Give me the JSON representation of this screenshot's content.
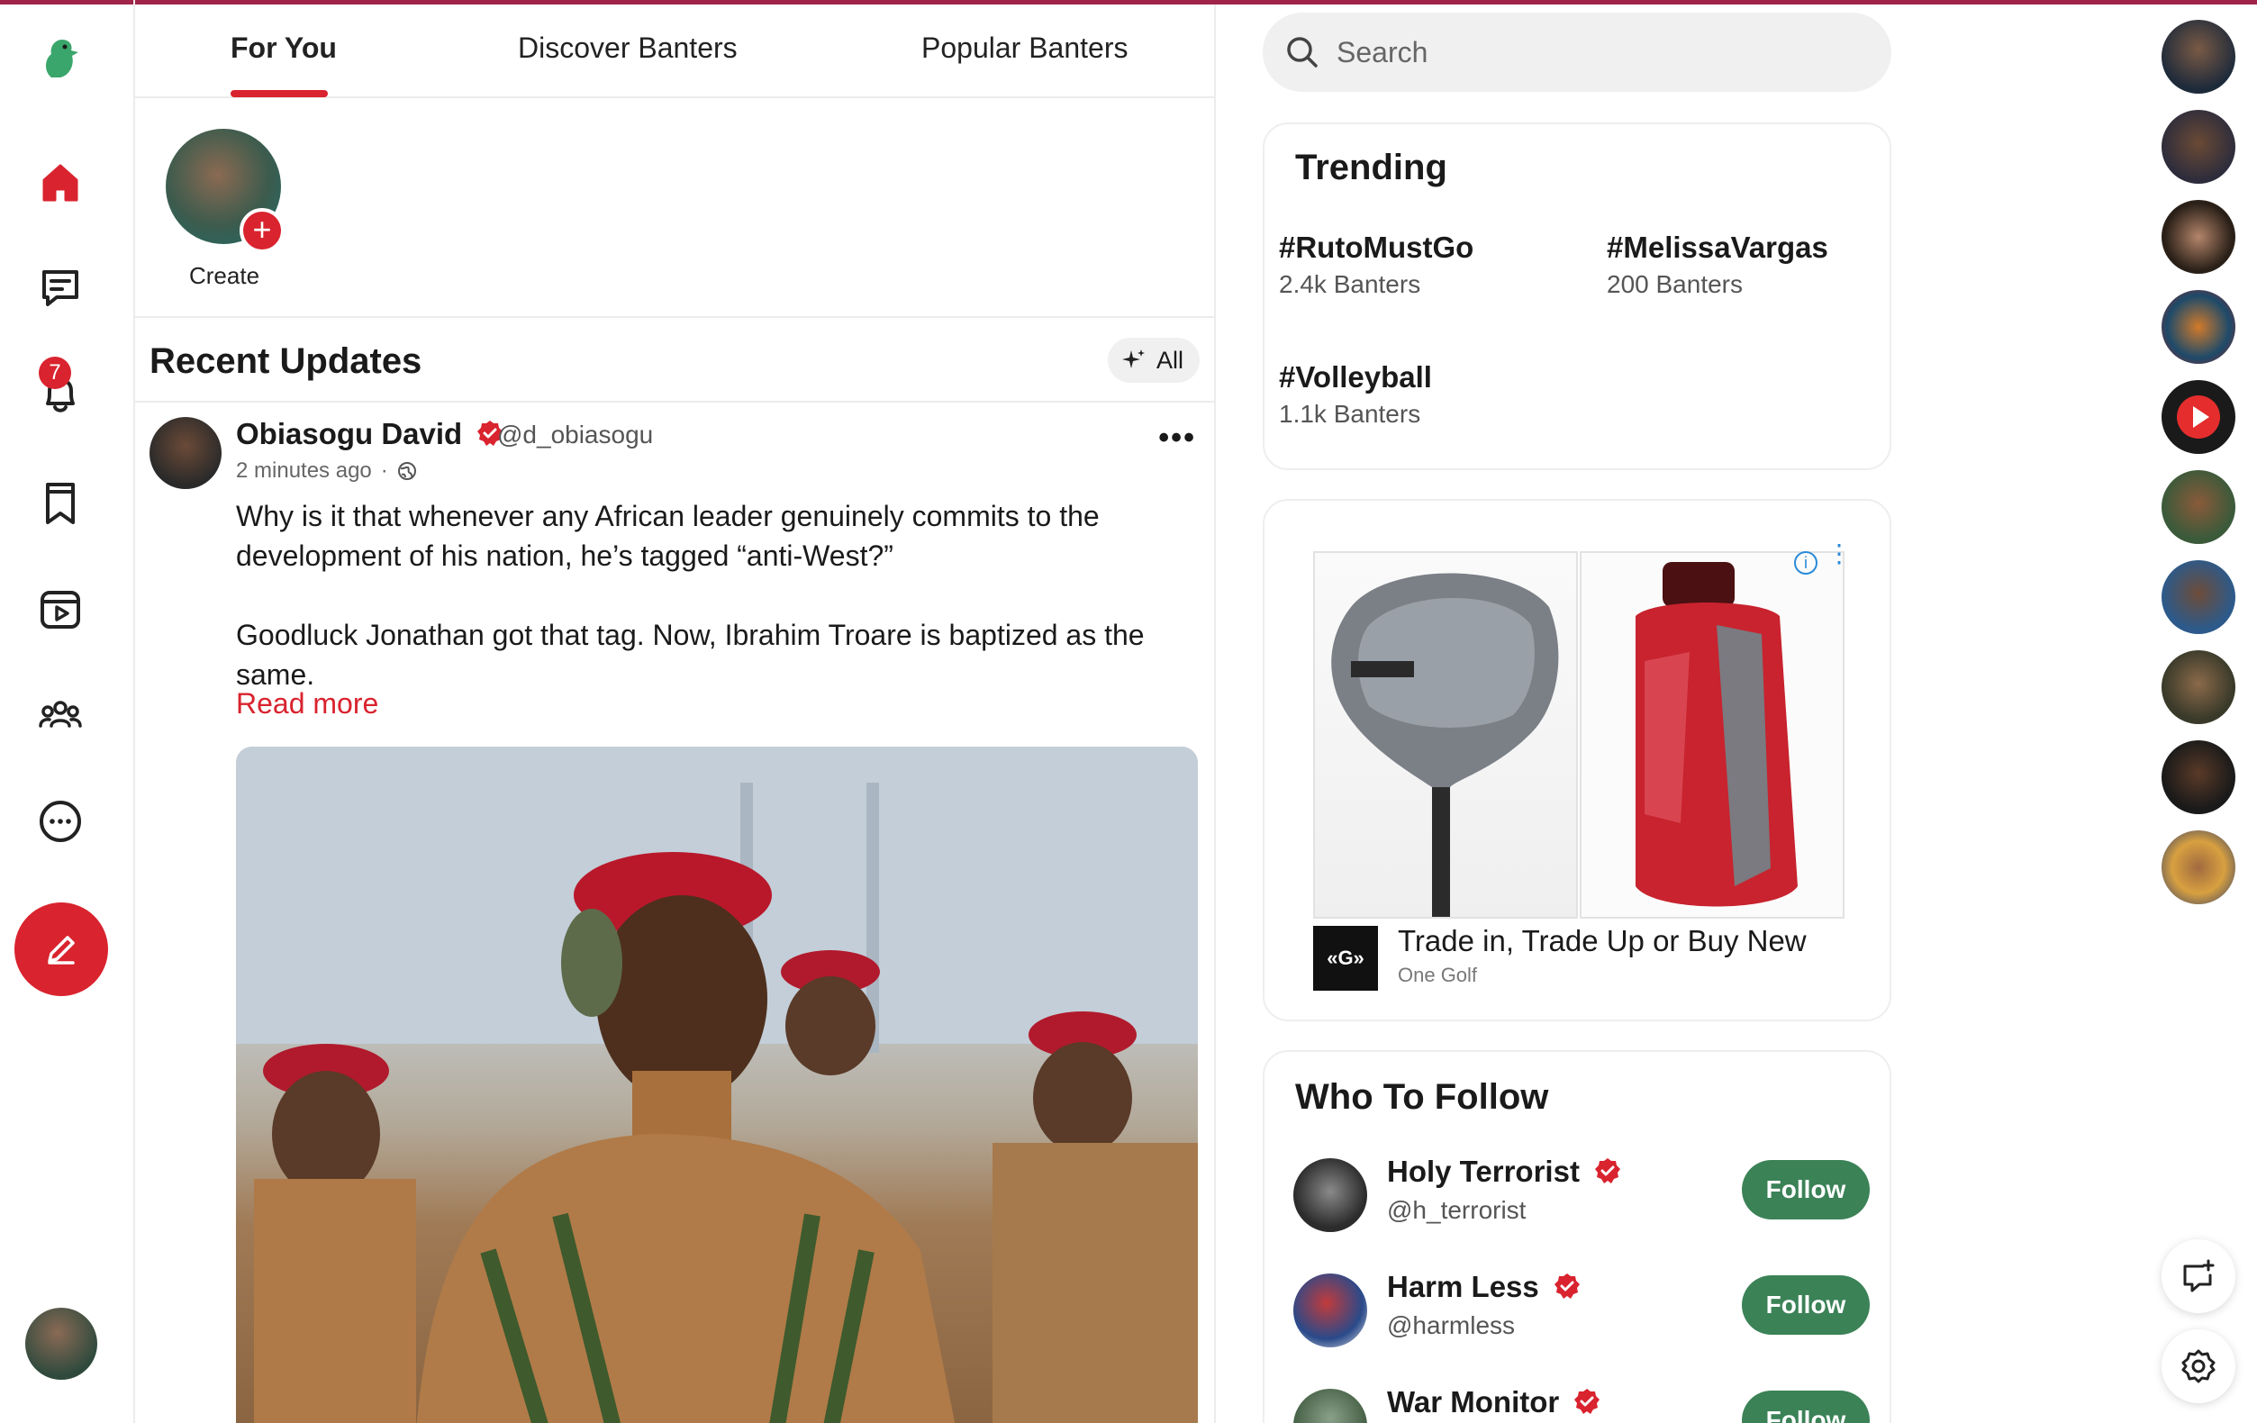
{
  "tabs": [
    "For You",
    "Discover Banters",
    "Popular Banters"
  ],
  "stories": {
    "create_label": "Create"
  },
  "notifications": {
    "count": "7"
  },
  "recent": {
    "title": "Recent Updates",
    "filter_label": "All"
  },
  "post": {
    "author": "Obiasogu David",
    "handle": "@d_obiasogu",
    "time": "2 minutes ago",
    "separator": "·",
    "paragraph1": "Why is it that whenever any African leader genuinely commits to the development of his nation, he’s tagged “anti-West?”",
    "paragraph2": "Goodluck Jonathan got that tag. Now, Ibrahim Troare is baptized as the same.",
    "read_more": "Read more",
    "more_label": "•••"
  },
  "search": {
    "placeholder": "Search"
  },
  "trending": {
    "title": "Trending",
    "items": [
      {
        "tag": "#RutoMustGo",
        "count": "2.4k Banters"
      },
      {
        "tag": "#MelissaVargas",
        "count": "200 Banters"
      },
      {
        "tag": "#Volleyball",
        "count": "1.1k Banters"
      }
    ]
  },
  "ad": {
    "title": "Trade in, Trade Up or Buy New",
    "advertiser": "One Golf",
    "logo_text": "«G»",
    "info": "i"
  },
  "who_to_follow": {
    "title": "Who To Follow",
    "button_label": "Follow",
    "items": [
      {
        "name": "Holy Terrorist",
        "handle": "@h_terrorist"
      },
      {
        "name": "Harm Less",
        "handle": "@harmless"
      },
      {
        "name": "War Monitor",
        "handle": ""
      }
    ]
  },
  "colors": {
    "accent": "#d9232e",
    "follow": "#3b8257",
    "logo": "#3aa66b"
  },
  "icons": [
    "logo-icon",
    "home-icon",
    "chat-icon",
    "bell-icon",
    "bookmark-icon",
    "video-icon",
    "community-icon",
    "more-icon",
    "edit-icon",
    "search-icon",
    "sparkle-icon",
    "globe-icon",
    "verified-icon",
    "new-chat-icon",
    "settings-icon"
  ]
}
